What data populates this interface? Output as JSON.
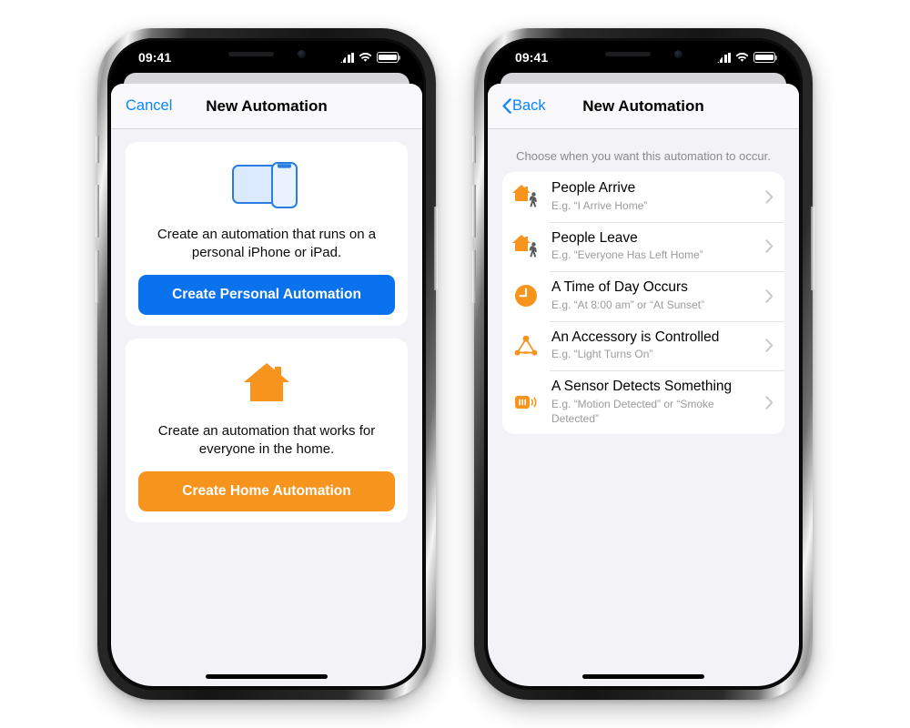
{
  "phones": [
    {
      "id": "left",
      "status_bar": {
        "time": "09:41",
        "signal": "cellular-bars-icon",
        "wifi": "wifi-icon",
        "battery": "battery-full-icon"
      },
      "nav": {
        "left_label": "Cancel",
        "title": "New Automation",
        "left_type": "text"
      },
      "cards": [
        {
          "art": "ipad-iphone-icon",
          "text": "Create an automation that runs on a personal iPhone or iPad.",
          "button_label": "Create Personal Automation",
          "button_color": "#0b72ed"
        },
        {
          "art": "house-icon",
          "text": "Create an automation that works for everyone in the home.",
          "button_label": "Create Home Automation",
          "button_color": "#f7941d"
        }
      ]
    },
    {
      "id": "right",
      "status_bar": {
        "time": "09:41",
        "signal": "cellular-bars-icon",
        "wifi": "wifi-icon",
        "battery": "battery-full-icon"
      },
      "nav": {
        "left_label": "Back",
        "title": "New Automation",
        "left_type": "back"
      },
      "caption": "Choose when you want this automation to occur.",
      "rows": [
        {
          "icon": "house-person-arrive-icon",
          "title": "People Arrive",
          "subtitle": "E.g. “I Arrive Home”"
        },
        {
          "icon": "house-person-leave-icon",
          "title": "People Leave",
          "subtitle": "E.g. “Everyone Has Left Home”"
        },
        {
          "icon": "clock-icon",
          "title": "A Time of Day Occurs",
          "subtitle": "E.g. “At 8:00 am” or “At Sunset”"
        },
        {
          "icon": "accessory-hub-icon",
          "title": "An Accessory is Controlled",
          "subtitle": "E.g. “Light Turns On”"
        },
        {
          "icon": "sensor-icon",
          "title": "A Sensor Detects Something",
          "subtitle": "E.g. “Motion Detected” or “Smoke Detected”"
        }
      ]
    }
  ],
  "colors": {
    "accent_blue": "#0b72ed",
    "accent_orange": "#f7941d",
    "link_blue": "#0a84ff",
    "sheet_bg": "#f2f2f7"
  }
}
